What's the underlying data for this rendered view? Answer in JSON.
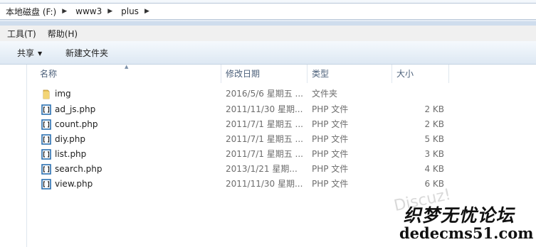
{
  "breadcrumb": {
    "drive": "本地磁盘 (F:)",
    "folder1": "www3",
    "folder2": "plus",
    "separator": "▶"
  },
  "menu": {
    "tools": "工具(T)",
    "help": "帮助(H)"
  },
  "command_bar": {
    "share": "共享",
    "new_folder": "新建文件夹"
  },
  "columns": {
    "name": "名称",
    "modified": "修改日期",
    "type": "类型",
    "size": "大小"
  },
  "files": [
    {
      "name": "img",
      "date": "2016/5/6 星期五 ...",
      "type": "文件夹",
      "size": "",
      "icon": "folder-icon"
    },
    {
      "name": "ad_js.php",
      "date": "2011/11/30 星期...",
      "type": "PHP 文件",
      "size": "2 KB",
      "icon": "php-file-icon"
    },
    {
      "name": "count.php",
      "date": "2011/7/1 星期五 ...",
      "type": "PHP 文件",
      "size": "2 KB",
      "icon": "php-file-icon"
    },
    {
      "name": "diy.php",
      "date": "2011/7/1 星期五 ...",
      "type": "PHP 文件",
      "size": "5 KB",
      "icon": "php-file-icon"
    },
    {
      "name": "list.php",
      "date": "2011/7/1 星期五 ...",
      "type": "PHP 文件",
      "size": "3 KB",
      "icon": "php-file-icon"
    },
    {
      "name": "search.php",
      "date": "2013/1/21 星期...",
      "type": "PHP 文件",
      "size": "4 KB",
      "icon": "php-file-icon"
    },
    {
      "name": "view.php",
      "date": "2011/11/30 星期...",
      "type": "PHP 文件",
      "size": "6 KB",
      "icon": "php-file-icon"
    }
  ],
  "watermark": {
    "title": "织梦无忧论坛",
    "url": "dedecms51.com",
    "faint": "Discuz!"
  },
  "colors": {
    "address_bg": "#e4ecf5",
    "command_bar_bg": "#dde8f3",
    "header_text": "#4c607a",
    "folder_yellow": "#e8c25a",
    "php_icon_blue": "#2a6fb0"
  }
}
